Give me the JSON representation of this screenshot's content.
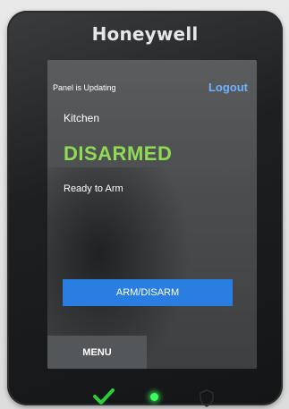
{
  "device": {
    "brand": "Honeywell",
    "led_color": "#3cff5a",
    "check_color": "#2ecc3a"
  },
  "screen": {
    "status_text": "Panel is Updating",
    "logout_label": "Logout",
    "partition_name": "Kitchen",
    "arm_state": "DISARMED",
    "ready_text": "Ready to Arm",
    "arm_disarm_label": "ARM/DISARM",
    "menu_label": "MENU",
    "accent_color": "#2a7de1",
    "state_color": "#8fdc54"
  }
}
